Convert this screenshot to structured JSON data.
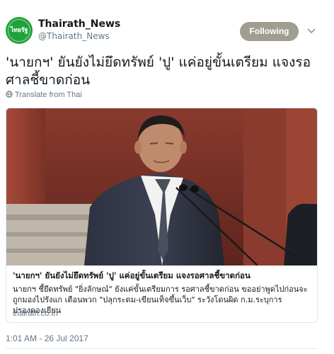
{
  "account": {
    "avatar_text": "ไทยรัฐ",
    "name": "Thairath_News",
    "handle": "@Thairath_News",
    "follow_label": "Following"
  },
  "tweet": {
    "text": "'นายกฯ' ยันยังไม่ยึดทรัพย์ 'ปู' แค่อยู่ขั้นเตรียม แจงรอศาลชี้ขาดก่อน",
    "translate_label": "Translate from Thai",
    "timestamp": "1:01 AM - 26 Jul 2017"
  },
  "card": {
    "title": "'นายกฯ' ยันยังไม่ยึดทรัพย์ 'ปู' แค่อยู่ขั้นเตรียม แจงรอศาลชี้ขาดก่อน",
    "description": "นายกฯ ชี้ยึดทรัพย์ \"ยิ่งลักษณ์\" ยังแค่ขั้นเตรียมการ รอศาลชี้ขาดก่อน ขออย่าพูดไปก่อนจะถูกมองไปรังแก เตือนพวก \"ปลุกระดม-เขียนเท็จขึ้นเว็บ\" ระวังโดนผิด ก.ม.ระบุการปรองดองเยียน",
    "domain": "thairath.co.th"
  },
  "colors": {
    "brand_green": "#1fa23a",
    "following_button": "#a09d92",
    "secondary_text": "#657786"
  },
  "icons": {
    "menu": "chevron-down-icon",
    "translate": "globe-icon"
  }
}
